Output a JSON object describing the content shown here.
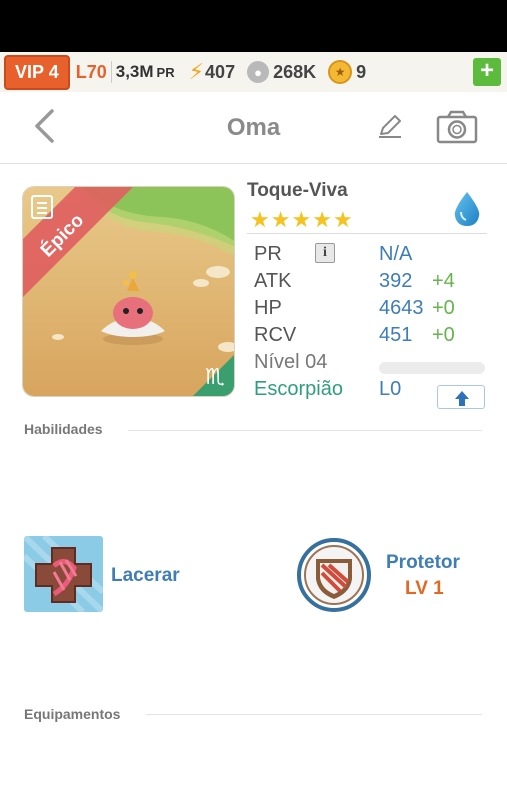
{
  "resources": {
    "vip": "VIP 4",
    "player_level": "L70",
    "power": "3,3M",
    "power_unit": "PR",
    "energy": "407",
    "food": "268K",
    "coins": "9"
  },
  "header": {
    "title": "Oma"
  },
  "monster": {
    "name": "Toque-Viva",
    "rarity": "Épico",
    "stars": 5,
    "element": "water-drop-icon",
    "stats": {
      "pr_label": "PR",
      "pr_value": "N/A",
      "atk_label": "ATK",
      "atk_value": "392",
      "atk_bonus": "+4",
      "hp_label": "HP",
      "hp_value": "4643",
      "hp_bonus": "+0",
      "rcv_label": "RCV",
      "rcv_value": "451",
      "rcv_bonus": "+0"
    },
    "level_label": "Nível 04",
    "sign_label": "Escorpião",
    "sign_level": "L0",
    "xp_progress": 0
  },
  "sections": {
    "skills": "Habilidades",
    "equipment": "Equipamentos"
  },
  "skills": {
    "active_name": "Lacerar",
    "passive_name": "Protetor",
    "passive_level": "LV 1"
  },
  "colors": {
    "accent_orange": "#e8612c",
    "stat_blue": "#3d7eb7",
    "bonus_green": "#66b54b",
    "sign_teal": "#2f9e7e",
    "rarity_red": "#e06060"
  }
}
